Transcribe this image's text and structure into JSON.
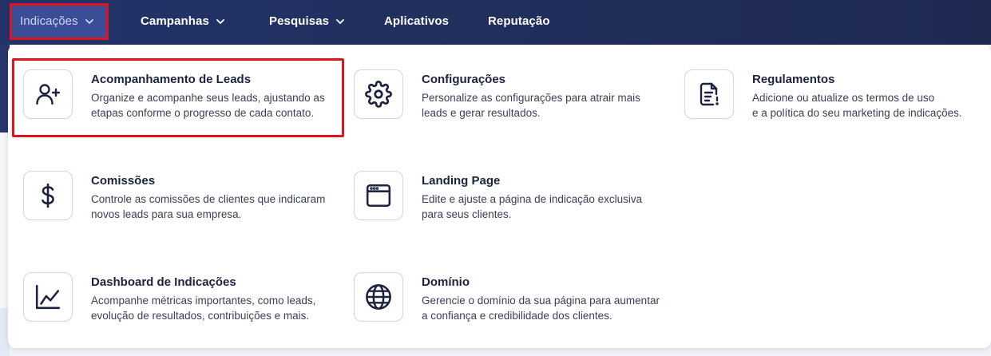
{
  "nav": {
    "items": [
      {
        "label": "Indicações",
        "has_dropdown": true,
        "active": true
      },
      {
        "label": "Campanhas",
        "has_dropdown": true
      },
      {
        "label": "Pesquisas",
        "has_dropdown": true
      },
      {
        "label": "Aplicativos",
        "has_dropdown": false
      },
      {
        "label": "Reputação",
        "has_dropdown": false
      }
    ]
  },
  "menu": {
    "cards": [
      {
        "icon": "user-plus-icon",
        "title": "Acompanhamento de Leads",
        "desc": [
          "Organize e acompanhe seus leads, ajustando as",
          "etapas conforme o progresso de cada contato."
        ],
        "highlighted": true
      },
      {
        "icon": "gear-icon",
        "title": "Configurações",
        "desc": [
          "Personalize as configurações para atrair mais",
          "leads e gerar resultados."
        ]
      },
      {
        "icon": "document-icon",
        "title": "Regulamentos",
        "desc": [
          "Adicione ou atualize os termos de uso",
          "e a política do seu marketing de indicações."
        ]
      },
      {
        "icon": "dollar-icon",
        "title": "Comissões",
        "desc": [
          "Controle as comissões de clientes que indicaram",
          "novos leads para sua empresa."
        ]
      },
      {
        "icon": "browser-window-icon",
        "title": "Landing Page",
        "desc": [
          "Edite e ajuste a página de indicação exclusiva",
          "para seus clientes."
        ]
      },
      {
        "icon": "line-chart-icon",
        "title": "Dashboard de Indicações",
        "desc": [
          "Acompanhe métricas importantes, como leads,",
          "evolução de resultados, contribuições e mais."
        ]
      },
      {
        "icon": "globe-icon",
        "title": "Domínio",
        "desc": [
          "Gerencie o domínio da sua página para aumentar",
          "a confiança e credibilidade dos clientes."
        ]
      }
    ]
  },
  "colors": {
    "topbar": "#23336a",
    "highlight_border": "#e0141f",
    "icon": "#1c2240",
    "title_text": "#1c2240"
  }
}
